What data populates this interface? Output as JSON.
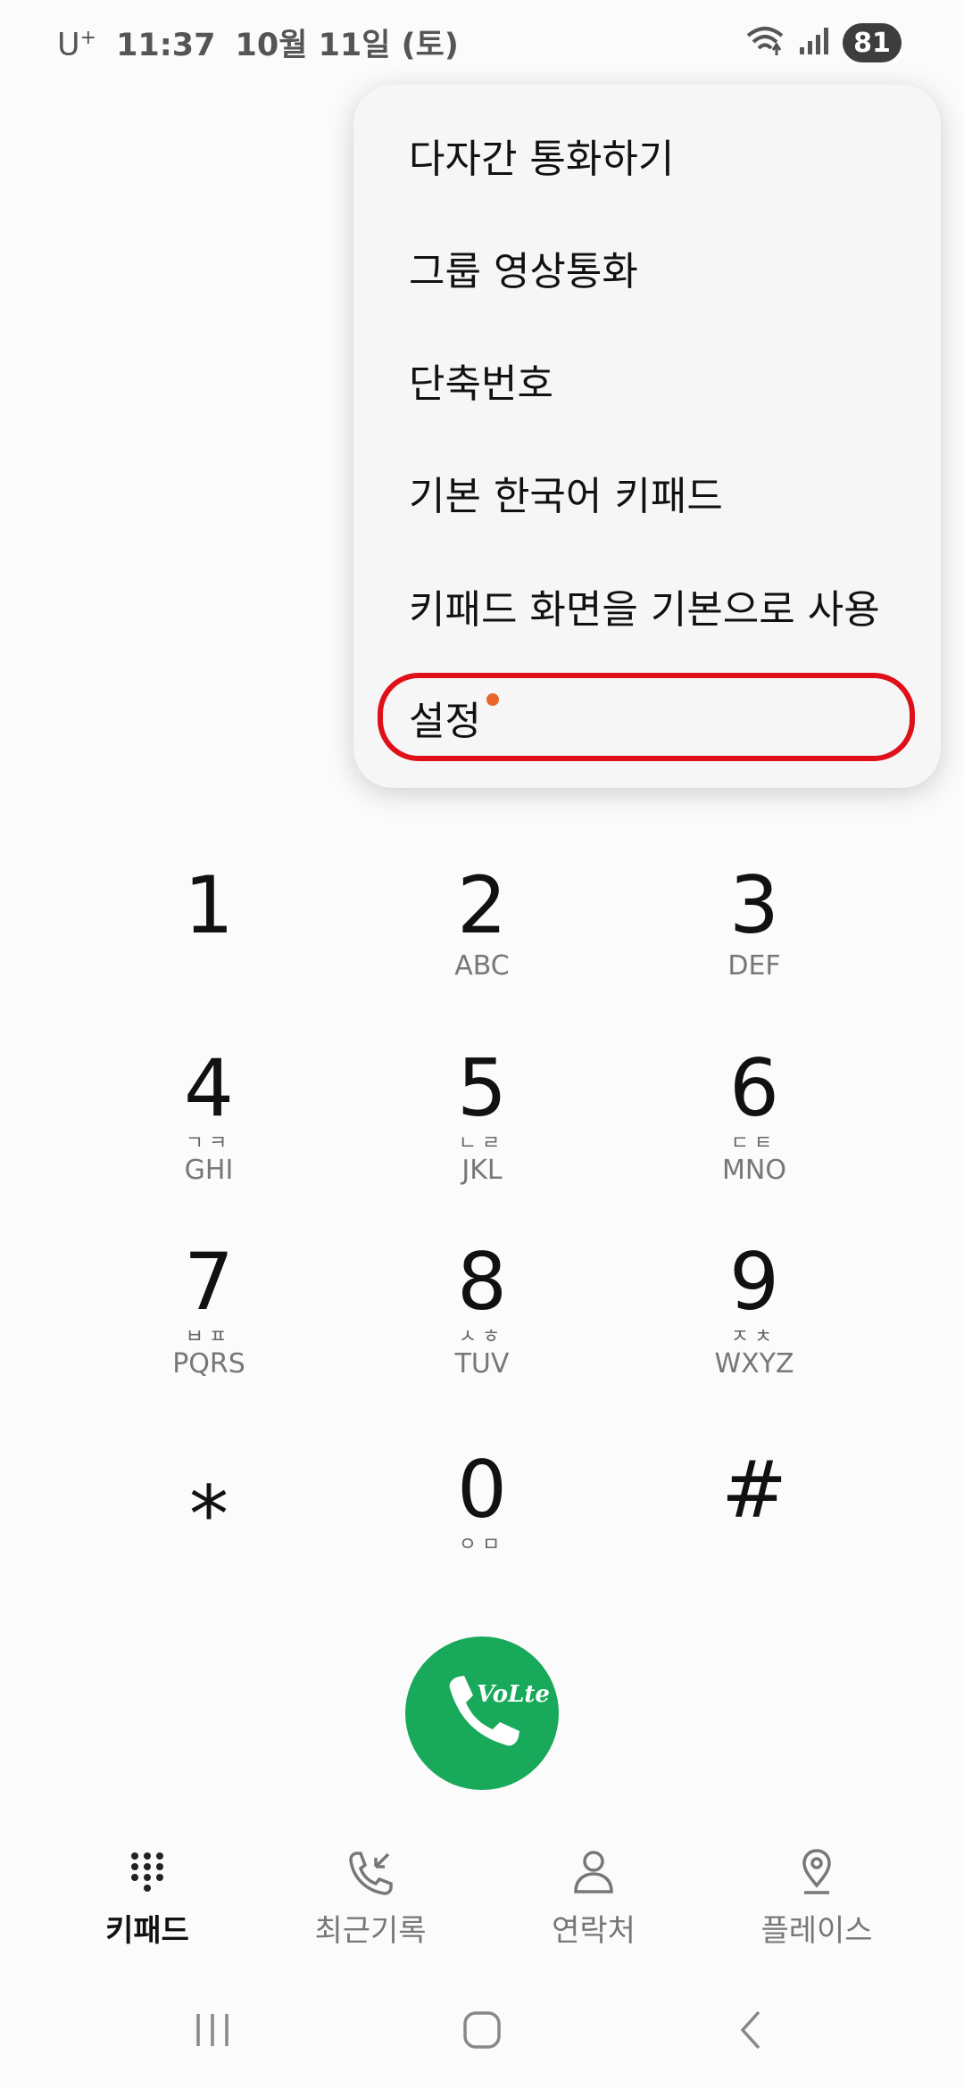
{
  "status_bar": {
    "carrier": "U",
    "carrier_sup": "+",
    "time": "11:37",
    "date": "10월 11일 (토)",
    "battery": "81"
  },
  "menu": {
    "items": [
      {
        "label": "다자간 통화하기"
      },
      {
        "label": "그룹 영상통화"
      },
      {
        "label": "단축번호"
      },
      {
        "label": "기본 한국어 키패드"
      },
      {
        "label": "키패드 화면을 기본으로 사용"
      },
      {
        "label": "설정"
      }
    ]
  },
  "dialpad": {
    "keys": [
      {
        "digit": "1",
        "jamo": "",
        "letters": ""
      },
      {
        "digit": "2",
        "jamo": "",
        "letters": "ABC"
      },
      {
        "digit": "3",
        "jamo": "",
        "letters": "DEF"
      },
      {
        "digit": "4",
        "jamo": "ㄱㅋ",
        "letters": "GHI"
      },
      {
        "digit": "5",
        "jamo": "ㄴㄹ",
        "letters": "JKL"
      },
      {
        "digit": "6",
        "jamo": "ㄷㅌ",
        "letters": "MNO"
      },
      {
        "digit": "7",
        "jamo": "ㅂㅍ",
        "letters": "PQRS"
      },
      {
        "digit": "8",
        "jamo": "ㅅㅎ",
        "letters": "TUV"
      },
      {
        "digit": "9",
        "jamo": "ㅈㅊ",
        "letters": "WXYZ"
      },
      {
        "digit": "⁎",
        "jamo": "",
        "letters": ""
      },
      {
        "digit": "0",
        "jamo": "ㅇㅁ",
        "letters": ""
      },
      {
        "digit": "#",
        "jamo": "",
        "letters": ""
      }
    ]
  },
  "call_button": {
    "badge": "VoLte",
    "color": "#18a95a"
  },
  "tabs": [
    {
      "label": "키패드",
      "icon": "keypad-icon",
      "active": true
    },
    {
      "label": "최근기록",
      "icon": "recent-calls-icon",
      "active": false
    },
    {
      "label": "연락처",
      "icon": "contacts-icon",
      "active": false
    },
    {
      "label": "플레이스",
      "icon": "places-icon",
      "active": false
    }
  ],
  "nav": [
    "recent-apps-icon",
    "home-icon",
    "back-icon"
  ],
  "colors": {
    "highlight": "#e0101a",
    "dot": "#e8662c",
    "call": "#18a95a"
  }
}
